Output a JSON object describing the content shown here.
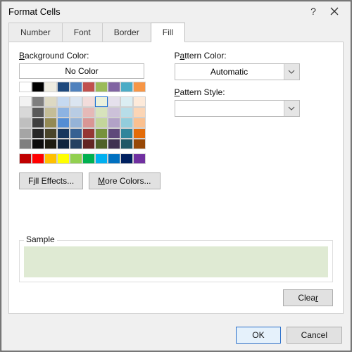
{
  "title": "Format Cells",
  "tabs": {
    "number": "Number",
    "font": "Font",
    "border": "Border",
    "fill": "Fill"
  },
  "labels": {
    "bg_color": "Background Color:",
    "no_color": "No Color",
    "pattern_color": "Pattern Color:",
    "pattern_style": "Pattern Style:",
    "sample": "Sample"
  },
  "combos": {
    "pattern_color_value": "Automatic",
    "pattern_style_value": ""
  },
  "buttons": {
    "fill_effects": "Fill Effects...",
    "more_colors": "More Colors...",
    "clear": "Clear",
    "ok": "OK",
    "cancel": "Cancel"
  },
  "sample_color": "#dfead3",
  "palette": {
    "row1": [
      "#ffffff",
      "#000000",
      "#eeece1",
      "#1f497d",
      "#4f81bd",
      "#c0504d",
      "#9bbb59",
      "#8064a2",
      "#4bacc6",
      "#f79646"
    ],
    "row2": [
      "#f2f2f2",
      "#7f7f7f",
      "#ddd9c3",
      "#c6d9f0",
      "#dbe5f1",
      "#f2dcdb",
      "#ebf1dd",
      "#e5e0ec",
      "#dbeef3",
      "#fdeada"
    ],
    "row3": [
      "#d8d8d8",
      "#595959",
      "#c4bd97",
      "#8db3e2",
      "#b8cce4",
      "#e5b9b7",
      "#d7e3bc",
      "#ccc1d9",
      "#b7dde8",
      "#fbd5b5"
    ],
    "row4": [
      "#bfbfbf",
      "#3f3f3f",
      "#938953",
      "#548dd4",
      "#95b3d7",
      "#d99694",
      "#c3d69b",
      "#b2a2c7",
      "#92cddc",
      "#fac08f"
    ],
    "row5": [
      "#a5a5a5",
      "#262626",
      "#494429",
      "#17365d",
      "#366092",
      "#953734",
      "#76923c",
      "#5f497a",
      "#31859b",
      "#e36c09"
    ],
    "row6": [
      "#7f7f7f",
      "#0c0c0c",
      "#1d1b10",
      "#0f243e",
      "#244061",
      "#632423",
      "#4f6128",
      "#3f3151",
      "#205867",
      "#974806"
    ],
    "row7": [
      "#c00000",
      "#ff0000",
      "#ffc000",
      "#ffff00",
      "#92d050",
      "#00b050",
      "#00b0f0",
      "#0070c0",
      "#002060",
      "#7030a0"
    ]
  },
  "selected_color": "#ebf1dd"
}
